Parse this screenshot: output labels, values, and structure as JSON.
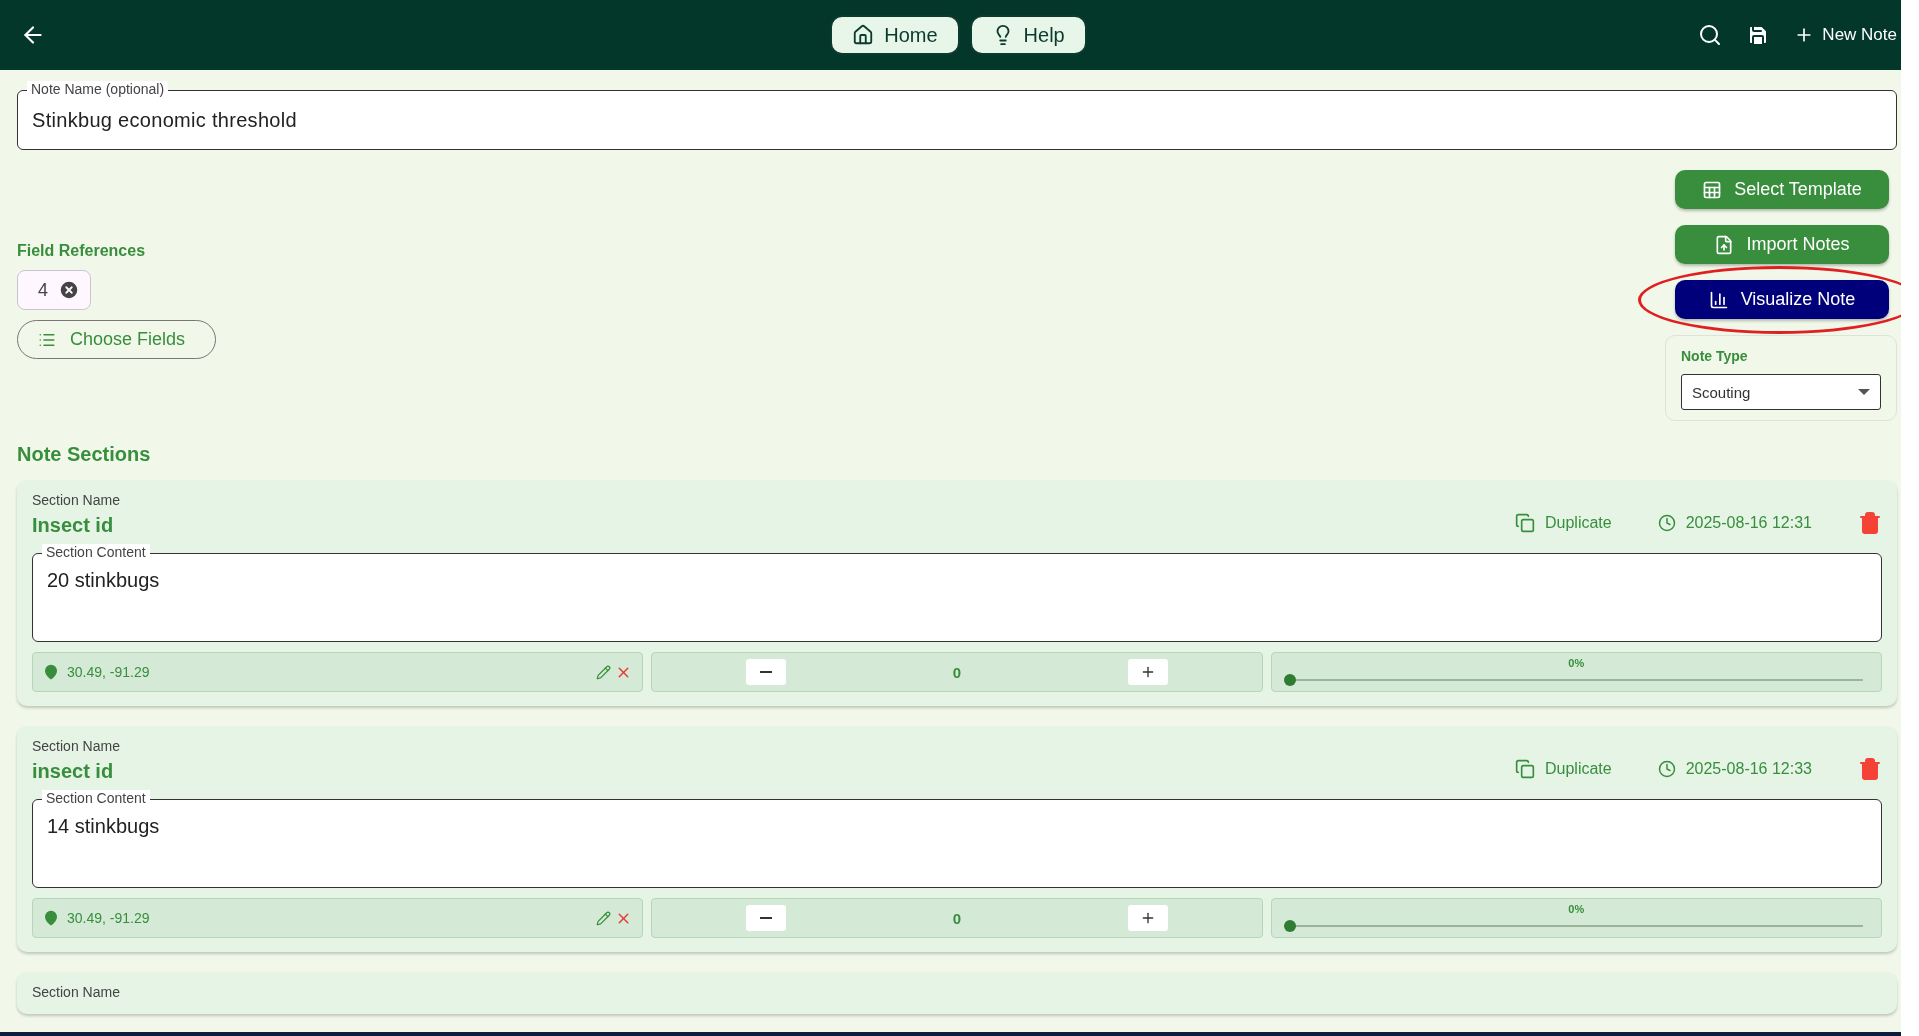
{
  "top_bar": {
    "nav_buttons": [
      {
        "label": "Home",
        "kind": "home"
      },
      {
        "label": "Help",
        "kind": "help"
      }
    ],
    "new_note": "New Note"
  },
  "note_name": {
    "label": "Note Name (optional)",
    "value": "Stinkbug economic threshold"
  },
  "actions": [
    {
      "label": "Select Template",
      "kind": "template",
      "highlighted": false
    },
    {
      "label": "Import Notes",
      "kind": "import",
      "highlighted": false
    },
    {
      "label": "Visualize Note",
      "kind": "visualize",
      "highlighted": true
    }
  ],
  "note_type": {
    "label": "Note Type",
    "value": "Scouting"
  },
  "field_references": {
    "label": "Field References",
    "chips": [
      "4"
    ],
    "choose_button": "Choose Fields"
  },
  "sections_title": "Note Sections",
  "sections": [
    {
      "name_label": "Section Name",
      "name": "Insect id",
      "duplicate": "Duplicate",
      "timestamp": "2025-08-16 12:31",
      "content_label": "Section Content",
      "content": "20 stinkbugs",
      "location": "30.49, -91.29",
      "count": "0",
      "level": 0,
      "reading": "0%"
    },
    {
      "name_label": "Section Name",
      "name": "insect id",
      "duplicate": "Duplicate",
      "timestamp": "2025-08-16 12:33",
      "content_label": "Section Content",
      "content": "14 stinkbugs",
      "location": "30.49, -91.29",
      "count": "0",
      "level": 0,
      "reading": "0%"
    },
    {
      "name_label": "Section Name"
    }
  ]
}
